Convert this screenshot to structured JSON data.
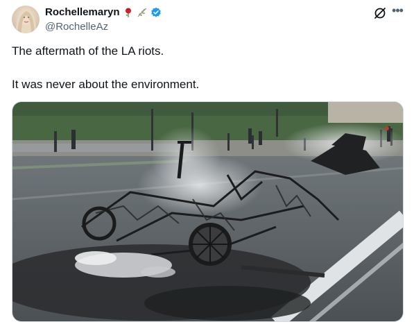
{
  "author": {
    "display_name": "Rochellemaryn",
    "handle": "@RochelleAz",
    "badges": [
      "rose-emoji",
      "olive-branch-emoji",
      "verified-badge"
    ]
  },
  "tweet": {
    "lines": [
      "The aftermath of the LA riots.",
      "It was never about the environment."
    ]
  },
  "media": {
    "type": "photo",
    "subject": "burned-out vehicle wreckage on a city street"
  },
  "icons": {
    "grok": "grok-icon",
    "more": "more-options-icon"
  },
  "colors": {
    "text": "#0f1419",
    "secondary_text": "#536471",
    "verified_blue": "#1d9bf0",
    "border": "#cfd9de"
  }
}
